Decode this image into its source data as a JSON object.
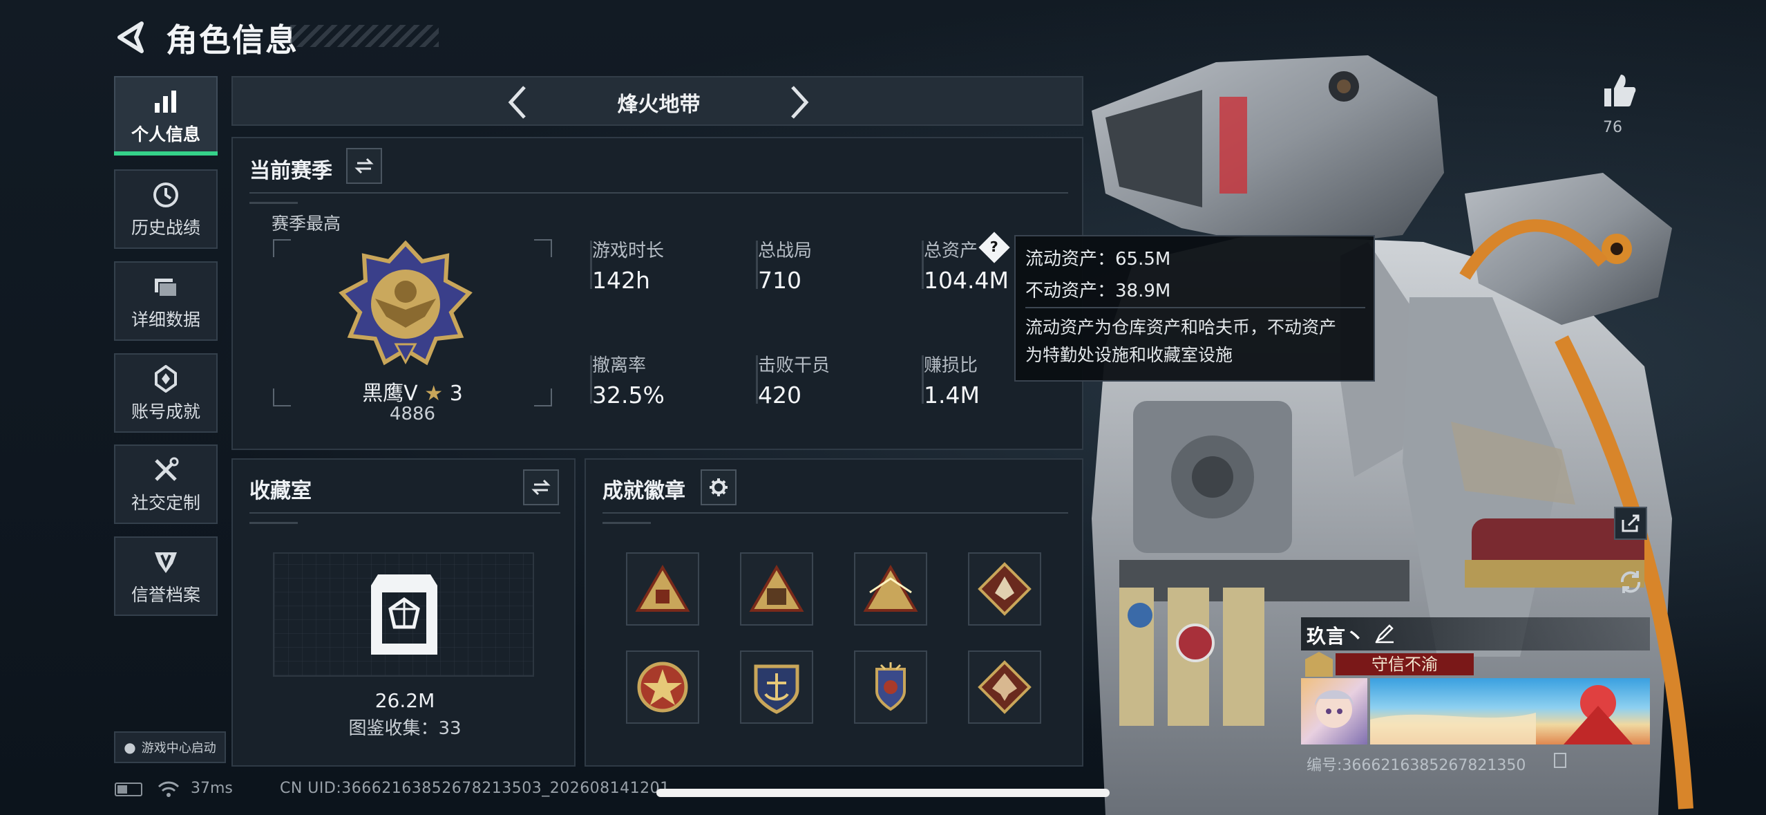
{
  "header": {
    "title": "角色信息"
  },
  "nav": [
    {
      "label": "个人信息",
      "icon": "bar-chart-icon",
      "active": true
    },
    {
      "label": "历史战绩",
      "icon": "history-clock-icon",
      "active": false
    },
    {
      "label": "详细数据",
      "icon": "folder-icon",
      "active": false
    },
    {
      "label": "账号成就",
      "icon": "achievement-icon",
      "active": false
    },
    {
      "label": "社交定制",
      "icon": "tools-icon",
      "active": false
    },
    {
      "label": "信誉档案",
      "icon": "credit-shield-icon",
      "active": false
    }
  ],
  "launch_badge": "游戏中心启动",
  "mode": {
    "title": "烽火地带"
  },
  "season": {
    "title": "当前赛季",
    "best_label": "赛季最高",
    "rank_name": "黑鹰V",
    "rank_stars": "3",
    "rank_score": "4886",
    "stats": [
      {
        "label": "游戏时长",
        "value": "142h"
      },
      {
        "label": "总战局",
        "value": "710"
      },
      {
        "label": "总资产",
        "value": "104.4M"
      },
      {
        "label": "撤离率",
        "value": "32.5%"
      },
      {
        "label": "击败干员",
        "value": "420"
      },
      {
        "label": "赚损比",
        "value": "1.4M"
      }
    ]
  },
  "tooltip": {
    "liquid": "流动资产：65.5M",
    "fixed": "不动资产：38.9M",
    "desc_line1": "流动资产为仓库资产和哈夫币，不动资产",
    "desc_line2": "为特勤处设施和收藏室设施"
  },
  "collection": {
    "title": "收藏室",
    "value": "26.2M",
    "catalog": "图鉴收集：33"
  },
  "achievements": {
    "title": "成就徽章",
    "badges": [
      "pyramid-badge-icon",
      "pyramid-58-badge-icon",
      "pyramid-59-badge-icon",
      "wolf-diamond-badge-icon",
      "star-medal-badge-icon",
      "anchor-shield-badge-icon",
      "winged-shield-badge-icon",
      "dragon-diamond-badge-icon"
    ]
  },
  "right": {
    "likes": "76",
    "player_name": "玖言丶",
    "player_tag": "守信不渝",
    "player_id": "编号:3666216385267821350"
  },
  "status": {
    "ping": "37ms",
    "uid": "CN UID:3666216385267821350​3_2026081412​01"
  },
  "colors": {
    "accent": "#35d28a",
    "gold": "#c9a65a",
    "tag_red": "#8b1a1a"
  }
}
